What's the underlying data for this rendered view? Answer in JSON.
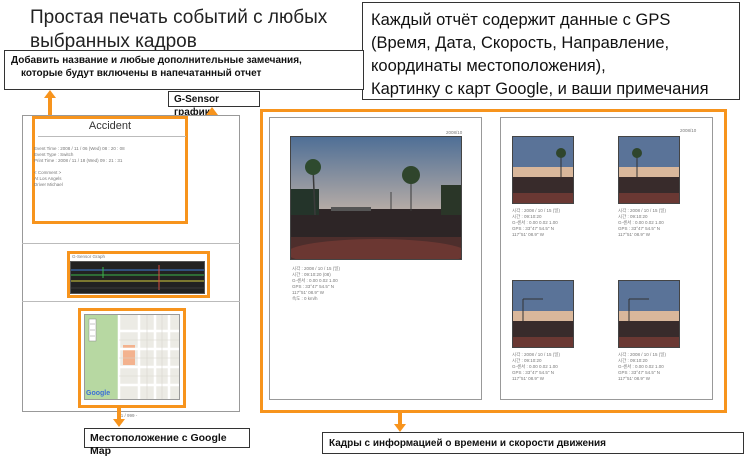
{
  "headline_left": {
    "line1": "Простая печать событий с любых",
    "line2": "выбранных кадров"
  },
  "headline_right": {
    "line1": "Каждый отчёт содержит данные с GPS",
    "line2": "(Время, Дата, Скорость, Направление,",
    "line3": "координаты местоположения),",
    "line4": "Картинку с карт Google, и ваши примечания"
  },
  "callouts": {
    "notes_line1": "Добавить название и любые дополнительные замечания,",
    "notes_line2": "которые будут включены в напечатанный отчет",
    "gsensor": "G-Sensor график",
    "map": "Местоположение с Google Map",
    "frames": "Кадры с информацией о времени и скорости движения"
  },
  "report": {
    "title": "Accident",
    "rows": [
      "Event Time : 2008 / 11 / 06   (Wed)    08 : 20 : 08",
      "Event Type : Switch",
      "Print Time : 2008 / 11 / 18  (Wed)     09 : 21 : 31",
      "",
      "< Comment >",
      "At Los Angels",
      "Driver Michael"
    ],
    "gsensor_caption": "G-Sensor Graph",
    "page_number": "- 1 / 999 -",
    "map_logo": "Google"
  },
  "frames": {
    "big_info": [
      "시각 : 2008 / 10 / 15 (일)",
      "시간 : 09:10:20 (08)",
      "G-센서 : 0.00 0.02 1.00",
      "GPS : 33°47' 54.5\" N",
      "      117°51' 08.9\" W",
      "속도 : 0 km/h"
    ],
    "small_info": [
      "시각 : 2008 / 10 / 15 (일)",
      "시간 : 09:10:20",
      "G-센서 : 0.00 0.02 1.00",
      "GPS : 33°47' 54.5\" N",
      "      117°51' 08.9\" W"
    ],
    "corner_label": "2008/10"
  },
  "colors": {
    "accent": "#f7941d",
    "border": "#333333"
  }
}
